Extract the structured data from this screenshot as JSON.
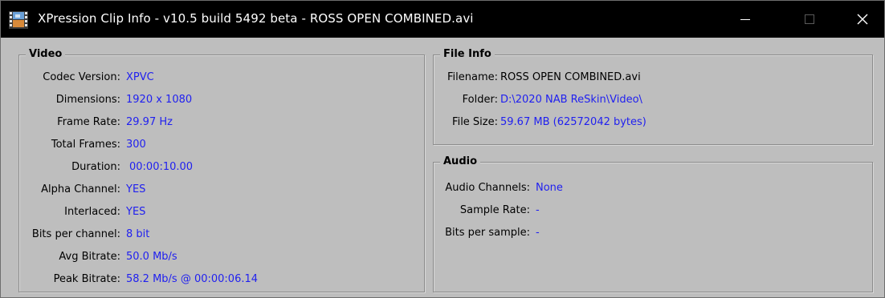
{
  "window": {
    "title": "XPression Clip Info - v10.5 build 5492 beta - ROSS OPEN COMBINED.avi",
    "icon": "film-strip-icon"
  },
  "video": {
    "group_title": "Video",
    "rows": [
      {
        "label": "Codec Version:",
        "value": "XPVC"
      },
      {
        "label": "Dimensions:",
        "value": "1920 x 1080"
      },
      {
        "label": "Frame Rate:",
        "value": "29.97 Hz"
      },
      {
        "label": "Total Frames:",
        "value": "300"
      },
      {
        "label": "Duration:",
        "value": "00:00:10.00"
      },
      {
        "label": "Alpha Channel:",
        "value": "YES"
      },
      {
        "label": "Interlaced:",
        "value": "YES"
      },
      {
        "label": "Bits per channel:",
        "value": "8 bit"
      },
      {
        "label": "Avg Bitrate:",
        "value": "50.0 Mb/s"
      },
      {
        "label": "Peak Bitrate:",
        "value": "58.2 Mb/s @ 00:00:06.14"
      }
    ]
  },
  "file_info": {
    "group_title": "File Info",
    "rows": [
      {
        "label": "Filename:",
        "value": "ROSS OPEN COMBINED.avi"
      },
      {
        "label": "Folder:",
        "value": "D:\\2020 NAB ReSkin\\Video\\"
      },
      {
        "label": "File Size:",
        "value": "59.67 MB (62572042 bytes)"
      }
    ]
  },
  "audio": {
    "group_title": "Audio",
    "rows": [
      {
        "label": "Audio Channels:",
        "value": "None"
      },
      {
        "label": "Sample Rate:",
        "value": "-"
      },
      {
        "label": "Bits per sample:",
        "value": "-"
      }
    ]
  },
  "colors": {
    "title_bar": "#000000",
    "panel_bg": "#bebebe",
    "value_text": "#1f1ff0"
  }
}
